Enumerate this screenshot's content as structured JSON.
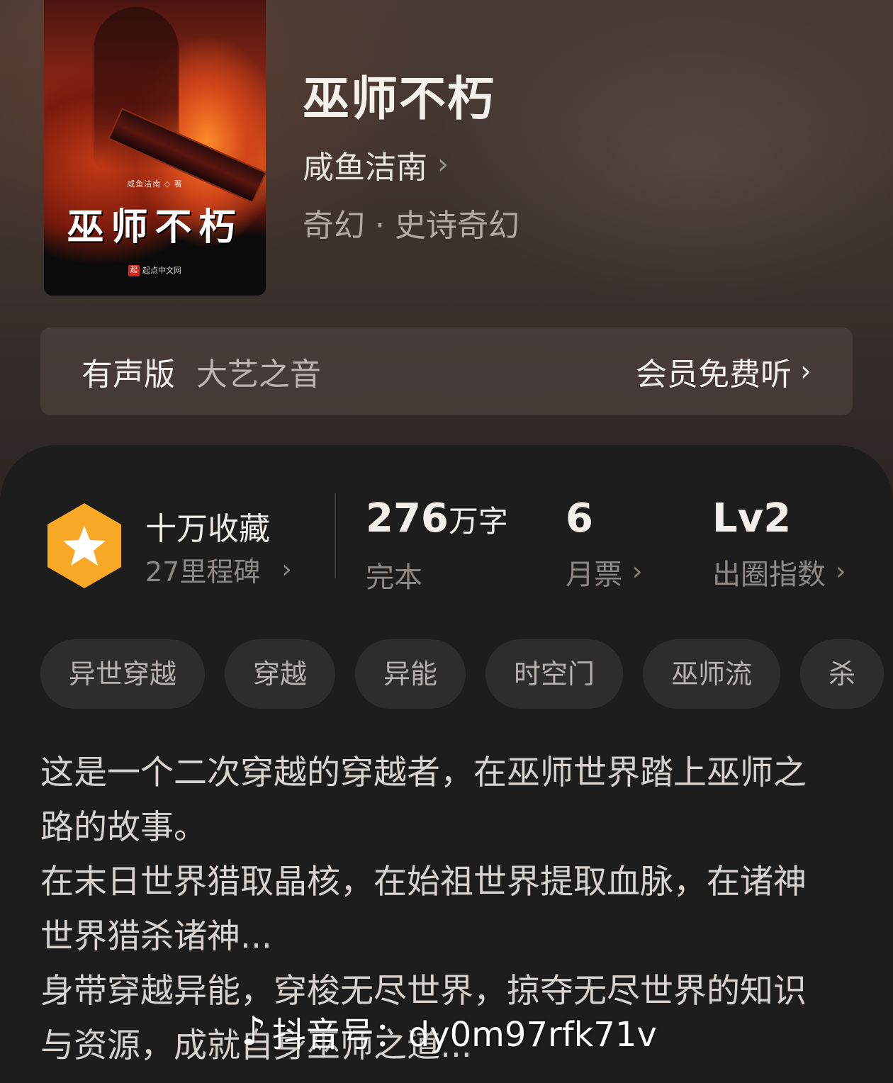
{
  "book": {
    "title": "巫师不朽",
    "author": "咸鱼洁南",
    "genre": "奇幻 · 史诗奇幻",
    "cover": {
      "title_text": "巫师不朽",
      "author_text": "咸鱼洁南 ◇ 著",
      "publisher_text": "起点中文网",
      "publisher_logo": "起"
    }
  },
  "audio": {
    "label": "有声版",
    "narrator": "大艺之音",
    "action": "会员免费听"
  },
  "stats": {
    "collection": {
      "title": "十万收藏",
      "milestone": "27里程碑"
    },
    "words": {
      "value": "276",
      "unit": "万字",
      "label": "完本"
    },
    "monthly_ticket": {
      "value": "6",
      "label": "月票"
    },
    "influence": {
      "value": "Lv2",
      "label": "出圈指数"
    }
  },
  "tags": [
    "异世穿越",
    "穿越",
    "异能",
    "时空门",
    "巫师流",
    "杀"
  ],
  "description": [
    "这是一个二次穿越的穿越者，在巫师世界踏上巫师之路的故事。",
    "在末日世界猎取晶核，在始祖世界提取血脉，在诸神世界猎杀诸神...",
    "身带穿越异能，穿梭无尽世界，掠夺无尽世界的知识与资源，成就自身巫师之道..."
  ],
  "watermark": {
    "icon": "tiktok-note-icon",
    "text": "抖音号：dy0m97rfk71v"
  },
  "colors": {
    "badge": "#f9a825",
    "background": "#1e1d1d",
    "tag_bg": "#2f2d2c"
  }
}
